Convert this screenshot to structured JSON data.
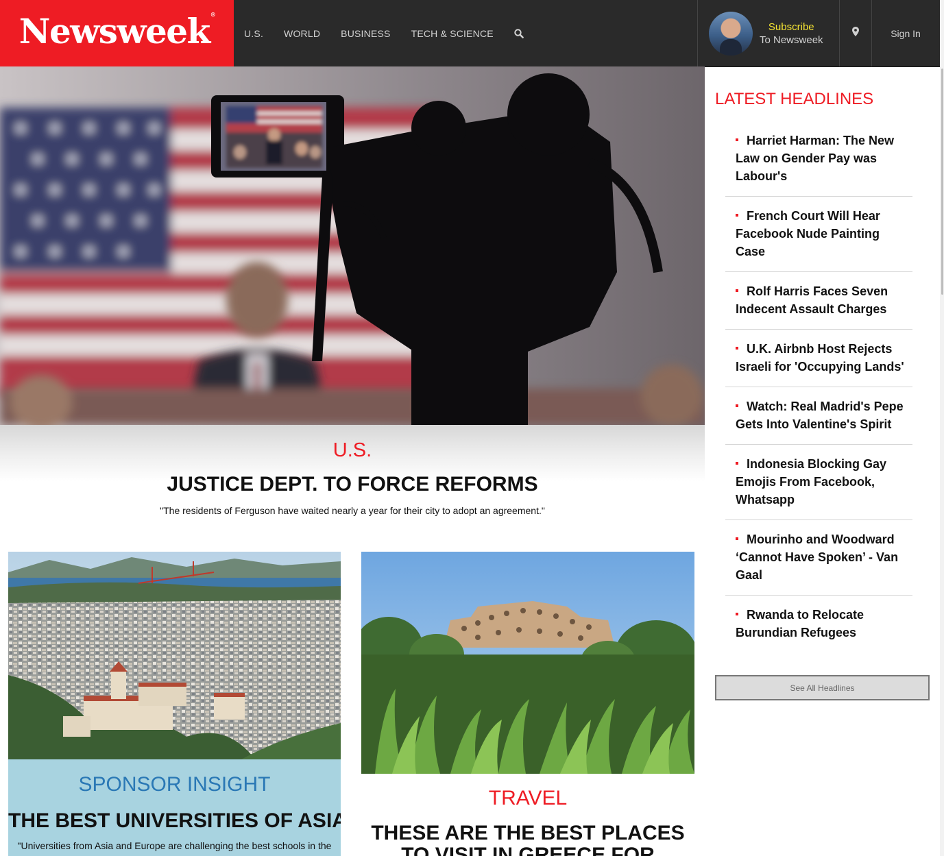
{
  "brand": {
    "logo_text": "Newsweek",
    "logo_mark": "®",
    "accent_color": "#ee1c24"
  },
  "nav": {
    "items": [
      "U.S.",
      "WORLD",
      "BUSINESS",
      "TECH & SCIENCE"
    ],
    "search_icon": "search-icon"
  },
  "account": {
    "subscribe_label": "Subscribe",
    "subscribe_sub": "To Newsweek",
    "location_icon": "map-pin-icon",
    "signin_label": "Sign In"
  },
  "hero": {
    "section": "U.S.",
    "title": "JUSTICE DEPT. TO FORCE REFORMS",
    "dek": "\"The residents of Ferguson have waited nearly a year for their city to adopt an agreement.\""
  },
  "cards": [
    {
      "section": "SPONSOR INSIGHT",
      "title": "THE BEST UNIVERSITIES OF ASIA",
      "dek": "\"Universities from Asia and Europe are challenging the best schools in the"
    },
    {
      "section": "TRAVEL",
      "title": "THESE ARE THE BEST PLACES TO VISIT IN GREECE FOR"
    }
  ],
  "sidebar": {
    "title": "LATEST HEADLINES",
    "headlines": [
      "Harriet Harman: The New Law on Gender Pay was Labour's",
      "French Court Will Hear Facebook Nude Painting Case",
      "Rolf Harris Faces Seven Indecent Assault Charges",
      "U.K. Airbnb Host Rejects Israeli for 'Occupying Lands'",
      "Watch: Real Madrid's Pepe Gets Into Valentine's Spirit",
      "Indonesia Blocking Gay Emojis From Facebook, Whatsapp",
      "Mourinho and Woodward ‘Cannot Have Spoken’ - Van Gaal",
      "Rwanda to Relocate Burundian Refugees"
    ],
    "see_all_label": "See All Headlines"
  }
}
